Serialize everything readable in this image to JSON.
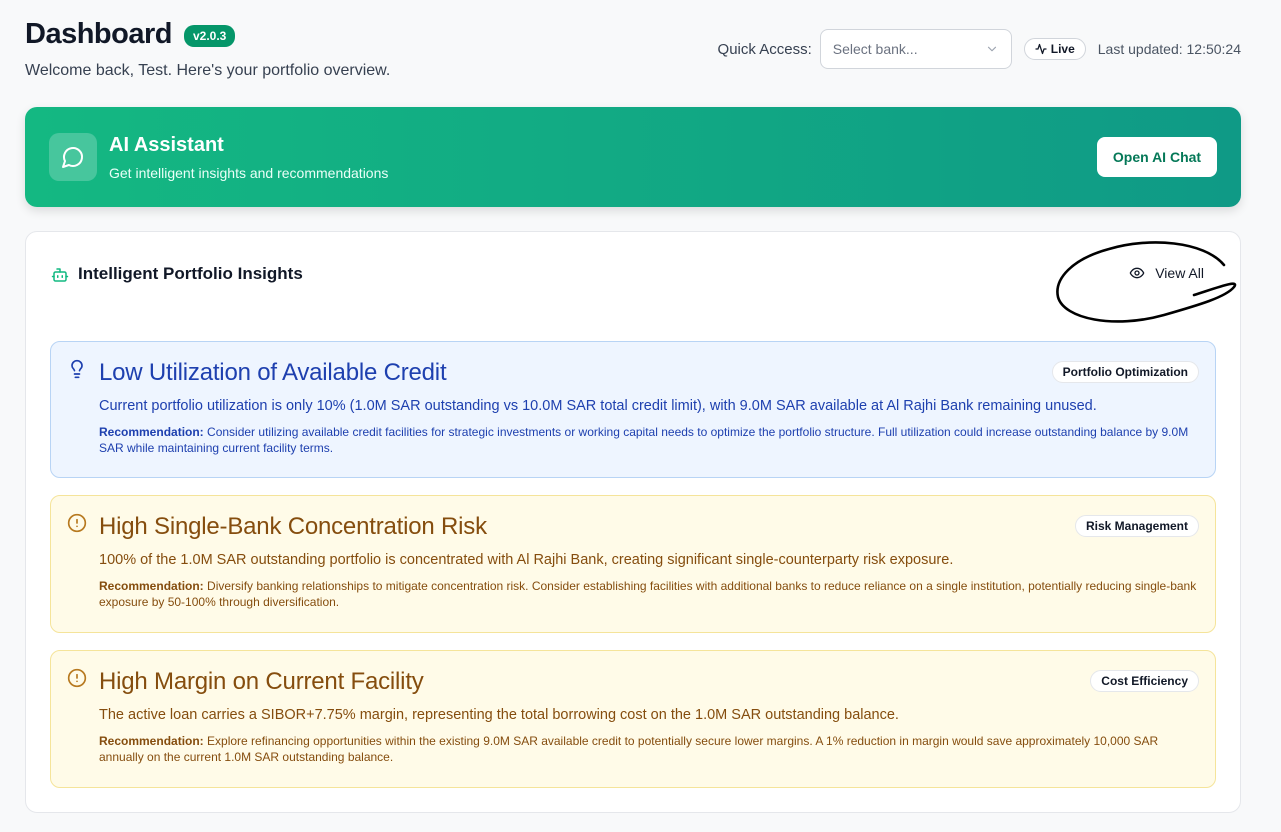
{
  "header": {
    "title": "Dashboard",
    "version": "v2.0.3",
    "welcome": "Welcome back, Test. Here's your portfolio overview.",
    "quick_access_label": "Quick Access:",
    "bank_select_placeholder": "Select bank...",
    "live_label": "Live",
    "last_updated": "Last updated: 12:50:24"
  },
  "ai_banner": {
    "title": "AI Assistant",
    "subtitle": "Get intelligent insights and recommendations",
    "button_label": "Open AI Chat"
  },
  "insights": {
    "title": "Intelligent Portfolio Insights",
    "view_all_label": "View All",
    "recommendation_label": "Recommendation:",
    "items": [
      {
        "title": "Low Utilization of Available Credit",
        "tag": "Portfolio Optimization",
        "description": "Current portfolio utilization is only 10% (1.0M SAR outstanding vs 10.0M SAR total credit limit), with 9.0M SAR available at Al Rajhi Bank remaining unused.",
        "recommendation": "Consider utilizing available credit facilities for strategic investments or working capital needs to optimize the portfolio structure. Full utilization could increase outstanding balance by 9.0M SAR while maintaining current facility terms.",
        "icon": "lightbulb-icon"
      },
      {
        "title": "High Single-Bank Concentration Risk",
        "tag": "Risk Management",
        "description": "100% of the 1.0M SAR outstanding portfolio is concentrated with Al Rajhi Bank, creating significant single-counterparty risk exposure.",
        "recommendation": "Diversify banking relationships to mitigate concentration risk. Consider establishing facilities with additional banks to reduce reliance on a single institution, potentially reducing single-bank exposure by 50-100% through diversification.",
        "icon": "alert-circle-icon"
      },
      {
        "title": "High Margin on Current Facility",
        "tag": "Cost Efficiency",
        "description": "The active loan carries a SIBOR+7.75% margin, representing the total borrowing cost on the 1.0M SAR outstanding balance.",
        "recommendation": "Explore refinancing opportunities within the existing 9.0M SAR available credit to potentially secure lower margins. A 1% reduction in margin would save approximately 10,000 SAR annually on the current 1.0M SAR outstanding balance.",
        "icon": "alert-circle-icon"
      }
    ]
  },
  "colors": {
    "brand_green": "#059669",
    "banner_start": "#14b882",
    "banner_end": "#0f9a86",
    "info_blue": "#1e40af",
    "warning_brown": "#854d0e"
  }
}
